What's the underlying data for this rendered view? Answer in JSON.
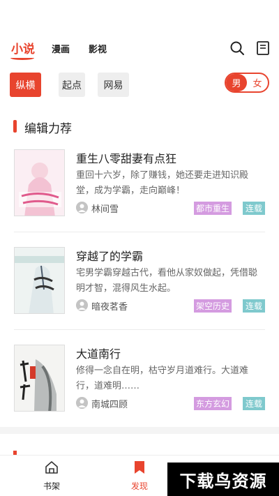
{
  "header": {
    "tabs": [
      {
        "label": "小说",
        "active": true
      },
      {
        "label": "漫画",
        "active": false
      },
      {
        "label": "影视",
        "active": false
      }
    ],
    "search_icon": "search-icon",
    "bookshelf_icon": "book-icon"
  },
  "sources": [
    {
      "label": "纵横",
      "active": true
    },
    {
      "label": "起点",
      "active": false
    },
    {
      "label": "网易",
      "active": false
    }
  ],
  "gender": {
    "male": "男",
    "female": "女",
    "selected": "男"
  },
  "section": {
    "title": "编辑力荐"
  },
  "books": [
    {
      "title": "重生八零甜妻有点狂",
      "desc": "重回十六岁，除了赚钱，她还要走进知识殿堂，成为学霸，走向巅峰！",
      "author": "林间雪",
      "genre": "都市重生",
      "status": "连载"
    },
    {
      "title": "穿越了的学霸",
      "desc": "宅男学霸穿越古代，看他从家奴做起，凭借聪明才智，混得风生水起。",
      "author": "暗夜茗香",
      "genre": "架空历史",
      "status": "连载"
    },
    {
      "title": "大道南行",
      "desc": "修得一念自在明，枯守岁月道难行。大道难行，道难明……",
      "author": "南城四顾",
      "genre": "东方玄幻",
      "status": "连载"
    }
  ],
  "bottom_nav": [
    {
      "label": "书架",
      "icon": "home-icon",
      "active": false
    },
    {
      "label": "发现",
      "icon": "bookmark-icon",
      "active": true
    }
  ],
  "watermark": "下载鸟资源",
  "colors": {
    "accent": "#e8442e",
    "genre_tag": "#d49be0",
    "status_tag": "#7fc9cd"
  }
}
